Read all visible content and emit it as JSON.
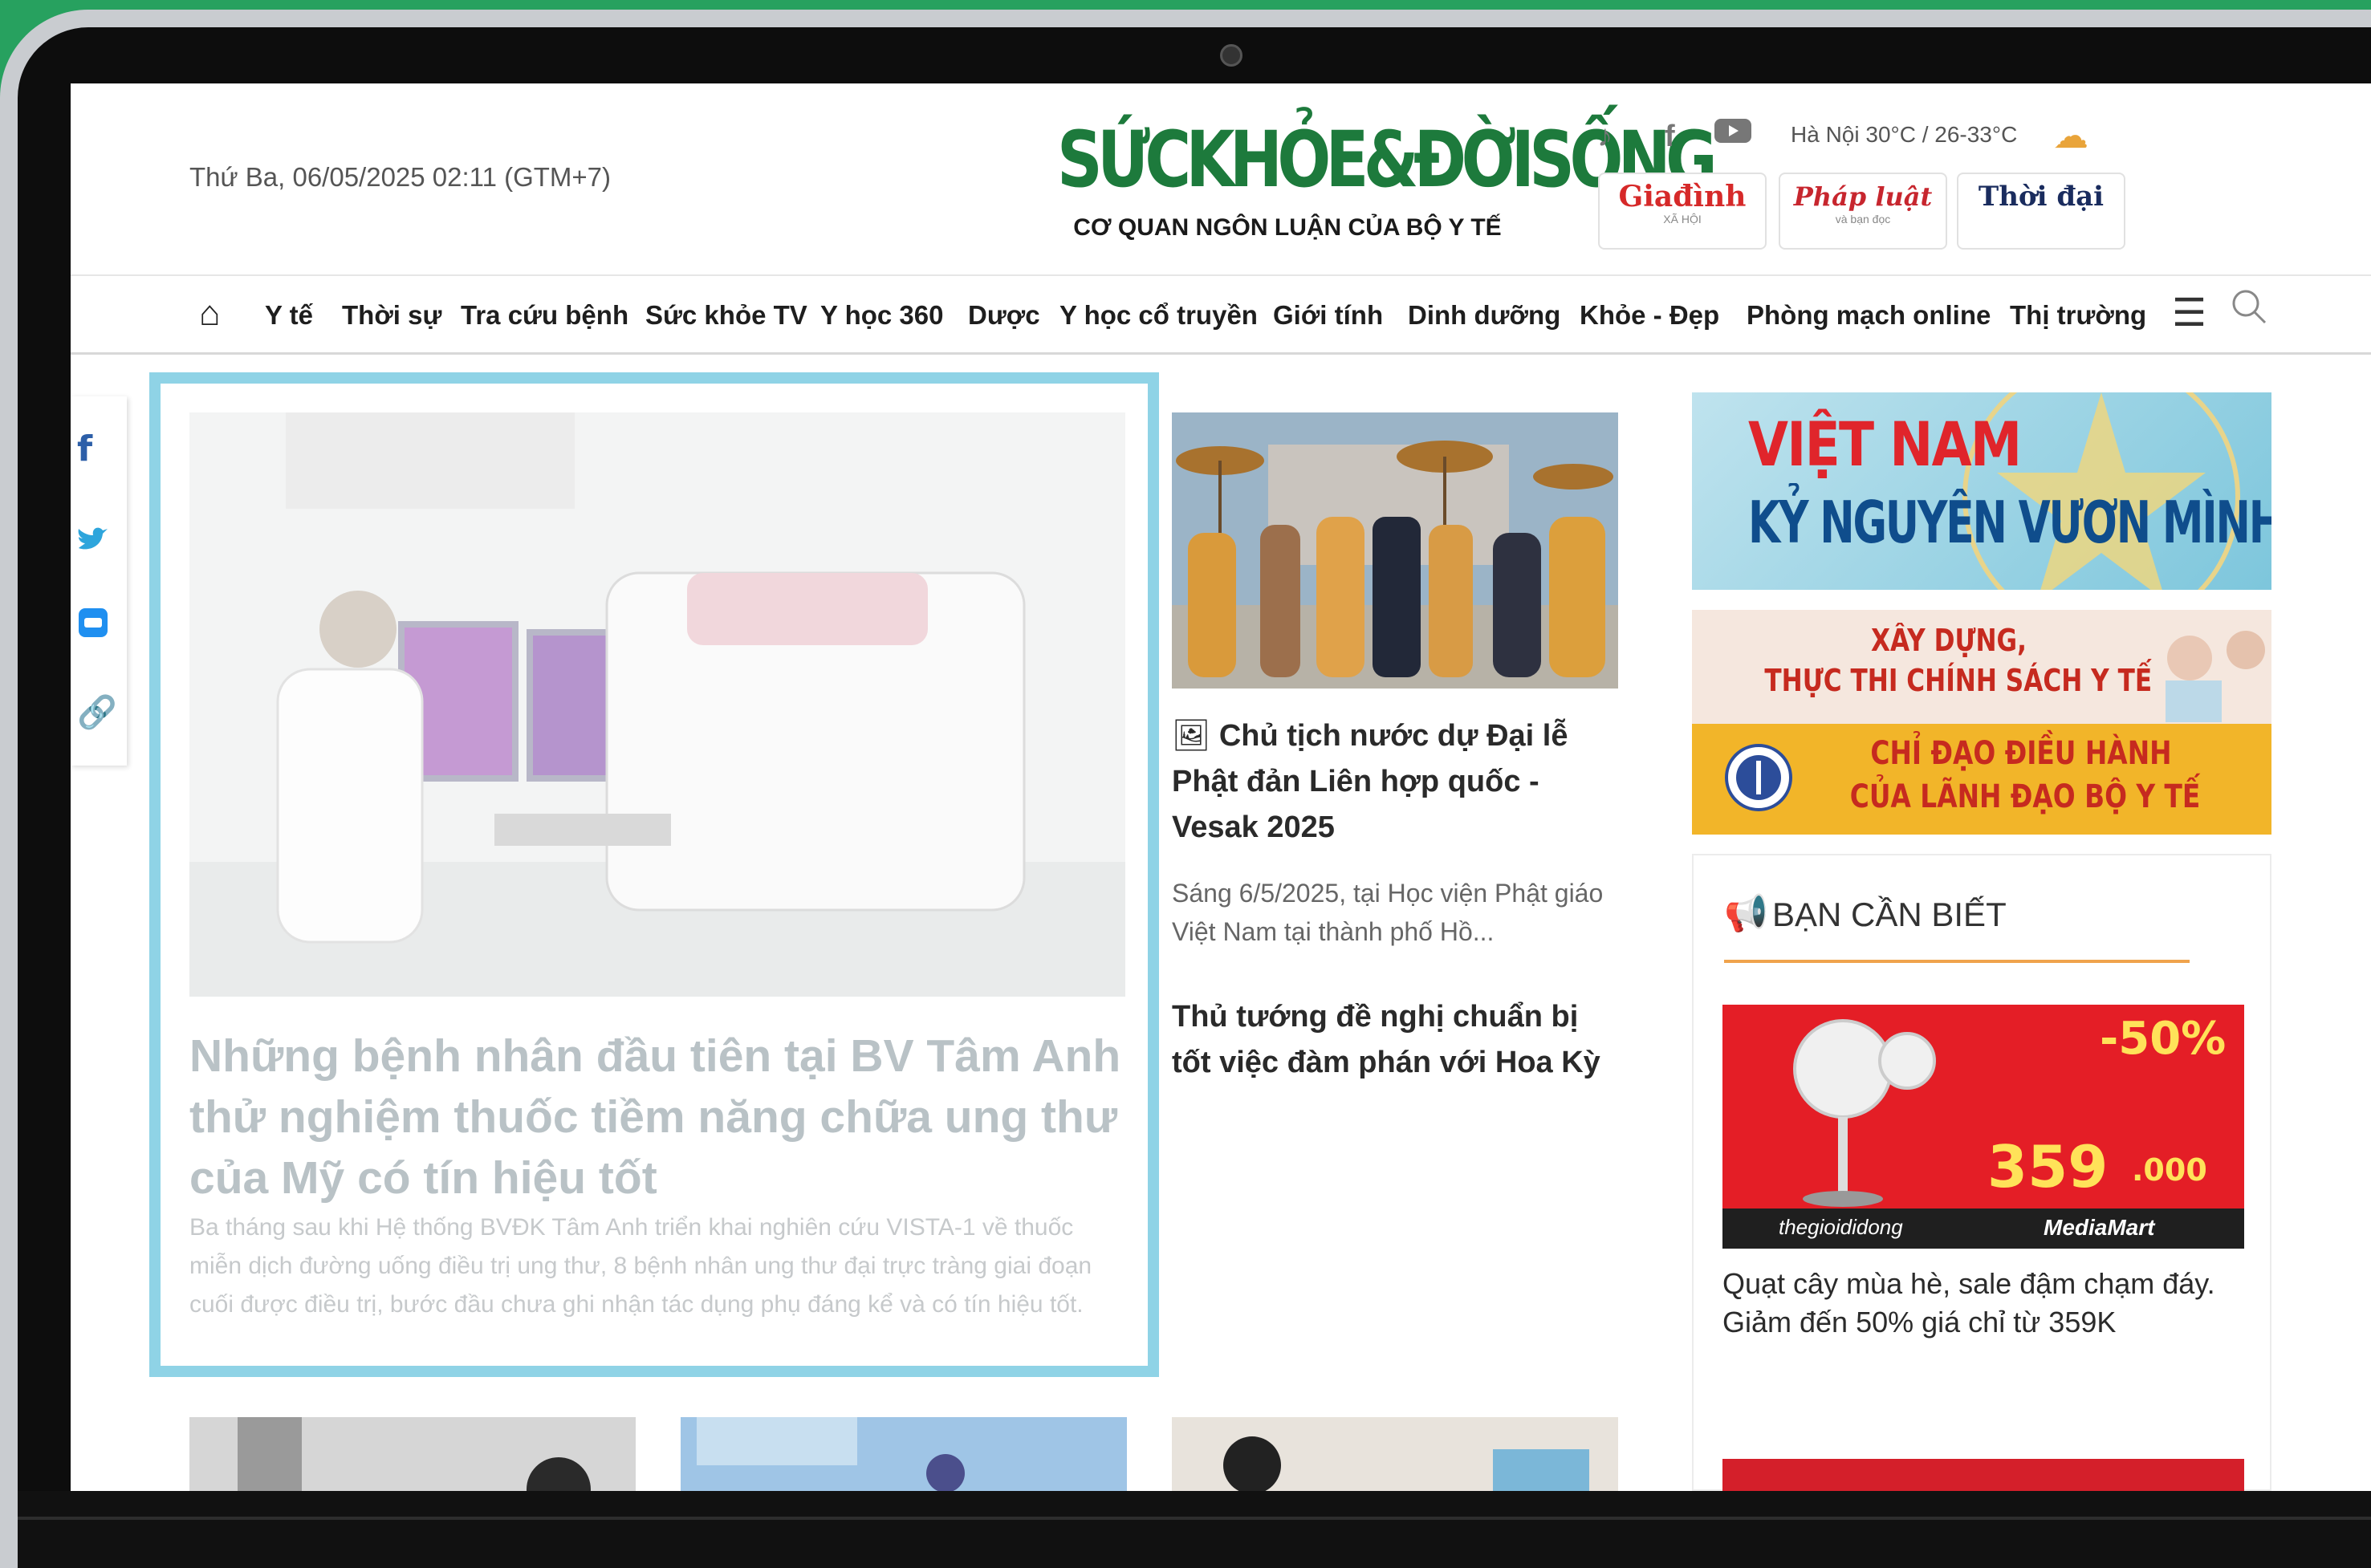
{
  "header": {
    "date": "Thứ Ba, 06/05/2025 02:11 (GTM+7)",
    "logo_name": "SỨCKHỎE&ĐỜISỐNG",
    "logo_tagline": "CƠ QUAN NGÔN LUẬN CỦA BỘ Y TẾ",
    "weather": "Hà Nội 30°C / 26-33°C",
    "partners": [
      {
        "name": "Giađình",
        "sub": "XÃ HỘI"
      },
      {
        "name": "Pháp luật",
        "sub": "và bạn đọc"
      },
      {
        "name": "Thời đại",
        "sub": ""
      }
    ]
  },
  "nav": {
    "items": [
      "Y tế",
      "Thời sự",
      "Tra cứu bệnh",
      "Sức khỏe TV",
      "Y học 360",
      "Dược",
      "Y học cổ truyền",
      "Giới tính",
      "Dinh dưỡng",
      "Khỏe - Đẹp",
      "Phòng mạch online",
      "Thị trường"
    ]
  },
  "featured": {
    "title": "Những bệnh nhân đầu tiên tại BV Tâm Anh thử nghiệm thuốc tiềm năng chữa ung thư của Mỹ có tín hiệu tốt",
    "summary": "Ba tháng sau khi Hệ thống BVĐK Tâm Anh triển khai nghiên cứu VISTA-1 về thuốc miễn dịch đường uống điều trị ung thư, 8 bệnh nhân ung thư đại trực tràng giai đoạn cuối được điều trị, bước đầu chưa ghi nhận tác dụng phụ đáng kể và có tín hiệu tốt."
  },
  "middle": {
    "article1_title": "Chủ tịch nước dự Đại lễ Phật đản Liên hợp quốc - Vesak 2025",
    "article1_summary": "Sáng 6/5/2025, tại Học viện Phật giáo Việt Nam tại thành phố Hồ...",
    "article2_title": "Thủ tướng đề nghị chuẩn bị tốt việc đàm phán với Hoa Kỳ"
  },
  "right": {
    "banner1_line1": "VIỆT NAM",
    "banner1_line2": "KỶ NGUYÊN VƯƠN MÌNH",
    "banner2_line1": "XÂY DỰNG,",
    "banner2_line2": "THỰC THI CHÍNH SÁCH Y TẾ",
    "banner2_line3": "CHỈ ĐẠO ĐIỀU HÀNH",
    "banner2_line4": "CỦA LÃNH ĐẠO BỘ Y TẾ",
    "section_title": "BẠN CẦN BIẾT",
    "ad_discount": "-50%",
    "ad_price": "359",
    "ad_price_unit": ".000",
    "ad_brand1": "thegioididong",
    "ad_brand2": "MediaMart",
    "ad_caption": "Quạt cây mùa hè, sale đậm chạm đáy. Giảm đến 50% giá chỉ từ 359K"
  }
}
